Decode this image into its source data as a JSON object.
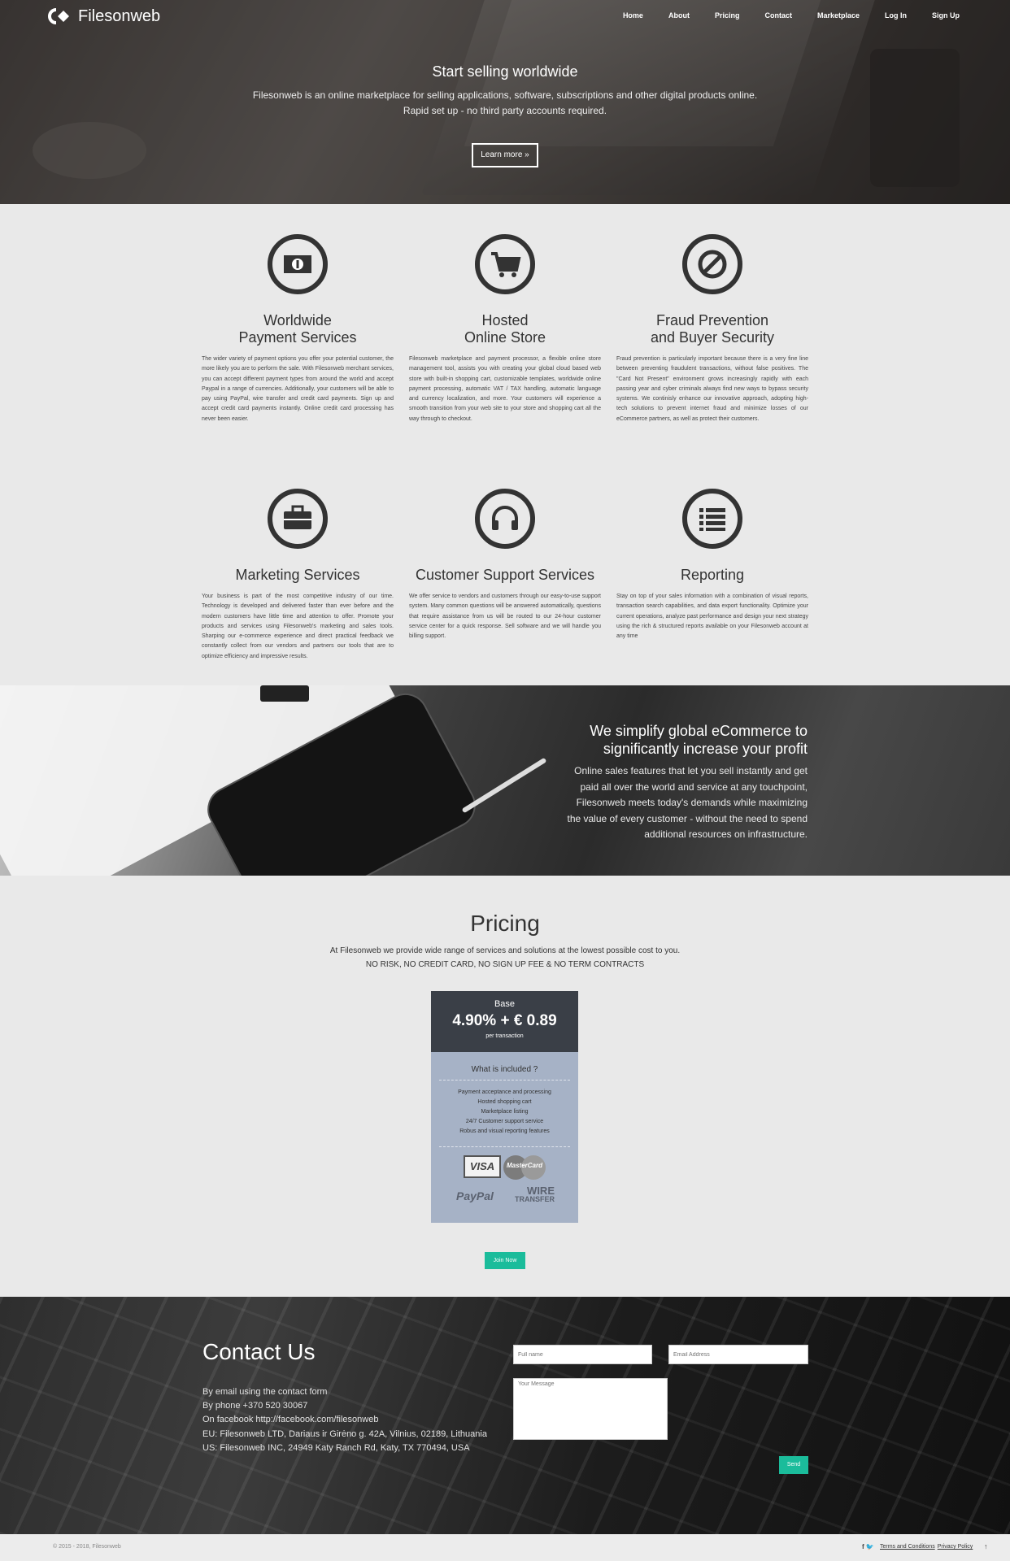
{
  "brand": {
    "name": "Filesonweb"
  },
  "nav": {
    "items": [
      "Home",
      "About",
      "Pricing",
      "Contact",
      "Marketplace",
      "Log In",
      "Sign Up"
    ]
  },
  "hero": {
    "title": "Start selling worldwide",
    "subtitle_line1": "Filesonweb is an online marketplace for selling applications, software, subscriptions and other digital products online.",
    "subtitle_line2": "Rapid set up - no third party accounts required.",
    "button": "Learn more »"
  },
  "features": [
    {
      "icon": "money-icon",
      "title_line1": "Worldwide",
      "title_line2": "Payment Services",
      "text": "The wider variety of payment options you offer your potential customer, the more likely you are to perform the sale. With Filesonweb merchant services, you can accept different payment types from around the world and accept Paypal in a range of currencies. Additionally, your customers will be able to pay using PayPal, wire transfer and credit card payments. Sign up and accept credit card payments instantly. Online credit card processing has never been easier."
    },
    {
      "icon": "cart-icon",
      "title_line1": "Hosted",
      "title_line2": "Online Store",
      "text": "Filesonweb marketplace and payment processor, a flexible online store management tool, assists you with creating your global cloud based web store with built-in shopping cart, customizable templates, worldwide online payment processing, automatic VAT / TAX handling, automatic language and currency localization, and more. Your customers will experience a smooth transition from your web site to your store and shopping cart all the way through to checkout."
    },
    {
      "icon": "ban-icon",
      "title_line1": "Fraud Prevention",
      "title_line2": "and Buyer Security",
      "text": "Fraud prevention is particularly important because there is a very fine line between preventing fraudulent transactions, without false positives. The \"Card Not Present\" environment grows increasingly rapidly with each passing year and cyber criminals always find new ways to bypass security systems. We continisly enhance our innovative approach, adopting high-tech solutions to prevent internet fraud and minimize losses of our eCommerce partners, as well as protect their customers."
    },
    {
      "icon": "briefcase-icon",
      "title_line1": "Marketing Services",
      "title_line2": "",
      "text": "Your business is part of the most competitive industry of our time. Technology is developed and delivered faster than ever before and the modern customers have little time and attention to offer. Promote your products and services using Filesonweb's marketing and sales tools. Sharping our e-commerce experience and direct practical feedback we constantly collect from our vendors and partners our tools that are to optimize efficiency and impressive results."
    },
    {
      "icon": "headphones-icon",
      "title_line1": "Customer Support Services",
      "title_line2": "",
      "text": "We offer service to vendors and customers through our easy-to-use support system. Many common questions will be answered automatically, questions that require assistance from us will be routed to our 24-hour customer service center for a quick response. Sell software and we will handle you billing support."
    },
    {
      "icon": "list-icon",
      "title_line1": "Reporting",
      "title_line2": "",
      "text": "Stay on top of your sales information with a combination of visual reports, transaction search capabilities, and data export functionality. Optimize your current operations, analyze past performance and design your next strategy using the rich & structured reports available on your Filesonweb account at any time"
    }
  ],
  "band": {
    "title_line1": "We simplify global eCommerce to",
    "title_line2": "significantly increase your profit",
    "lines": [
      "Online sales features that let you sell instantly and get",
      "paid all over the world and service at any touchpoint,",
      "Filesonweb meets today's demands while maximizing",
      "the value of every customer - without the need to spend",
      "additional resources on infrastructure."
    ]
  },
  "pricing": {
    "title": "Pricing",
    "subtitle": "At Filesonweb we provide wide range of services and solutions at the lowest possible cost to you.",
    "subtitle2": "NO RISK, NO CREDIT CARD, NO SIGN UP FEE & NO TERM CONTRACTS",
    "card": {
      "plan": "Base",
      "price": "4.90% + € 0.89",
      "per": "per transaction",
      "included_title": "What is included ?",
      "features": [
        "Payment acceptance and processing",
        "Hosted shopping cart",
        "Marketplace listing",
        "24/7 Customer support service",
        "Robus and visual reporting features"
      ],
      "payment_logos": {
        "visa": "VISA",
        "mastercard": "MasterCard",
        "paypal": "PayPal",
        "wire_line1": "WIRE",
        "wire_line2": "TRANSFER"
      }
    },
    "join_button": "Join Now"
  },
  "contact": {
    "title": "Contact Us",
    "lines": [
      "By email using the contact form",
      "By phone +370 520 30067",
      "On facebook http://facebook.com/filesonweb",
      "EU: Filesonweb LTD, Dariaus ir Girėno g. 42A, Vilnius, 02189, Lithuania",
      "US: Filesonweb INC, 24949 Katy Ranch Rd, Katy, TX 770494, USA"
    ],
    "form": {
      "name_placeholder": "Full name",
      "email_placeholder": "Email Address",
      "message_placeholder": "Your Message",
      "send": "Send"
    }
  },
  "footer": {
    "copyright": "© 2015 - 2018, Filesonweb",
    "social": "f 🐦",
    "links": [
      "Terms and Conditions",
      "Privacy Policy"
    ],
    "scroll_top": "↑"
  },
  "colors": {
    "accent": "#1bbc9b",
    "dark": "#3a3f47",
    "card": "#a6b2c6"
  }
}
